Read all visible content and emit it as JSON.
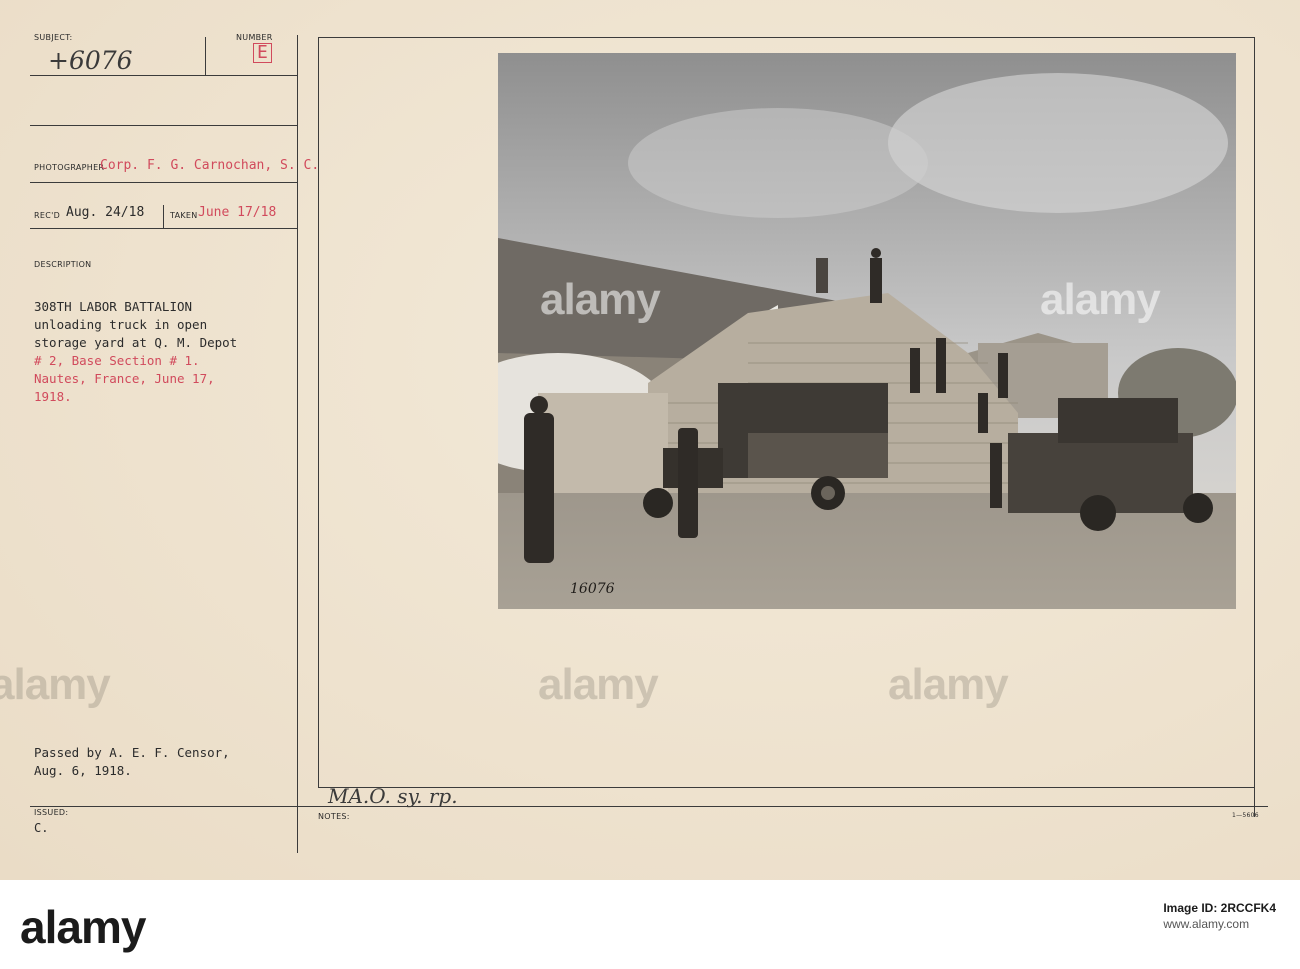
{
  "card": {
    "subject_label": "SUBJECT:",
    "subject_value": "+6076",
    "number_label": "NUMBER",
    "number_value": "E",
    "photographer_label": "PHOTOGRAPHER",
    "photographer_value": "Corp. F. G. Carnochan, S. C.",
    "recd_label": "REC'D",
    "recd_value": "Aug. 24/18",
    "taken_label": "TAKEN",
    "taken_value": "June 17/18",
    "description_label": "DESCRIPTION",
    "description_lines": [
      {
        "text": "308TH LABOR BATTALION",
        "color": "black"
      },
      {
        "text": "unloading truck in open",
        "color": "black"
      },
      {
        "text": "storage yard at Q. M. Depot",
        "color": "black"
      },
      {
        "text": "# 2, Base Section # 1.",
        "color": "red"
      },
      {
        "text": "Nautes, France, June 17,",
        "color": "red"
      },
      {
        "text": "1918.",
        "color": "red"
      }
    ],
    "censor_line1": "Passed by A. E. F. Censor,",
    "censor_line2": "Aug. 6, 1918.",
    "issued_label": "ISSUED:",
    "issued_value": "C.",
    "notes_label": "NOTES:",
    "notes_value": "MA.O. sy. rp.",
    "form_number": "1—5606",
    "photo_number": "16076"
  },
  "watermarks": [
    "alamy",
    "alamy",
    "alamy",
    "alamy",
    "alamy"
  ],
  "footer": {
    "logo": "alamy",
    "image_id_label": "Image ID: 2RCCFK4",
    "url": "www.alamy.com"
  },
  "colors": {
    "card": "#efe4d3",
    "typed_red": "#d14a5c",
    "ink": "#2c2c2c"
  }
}
